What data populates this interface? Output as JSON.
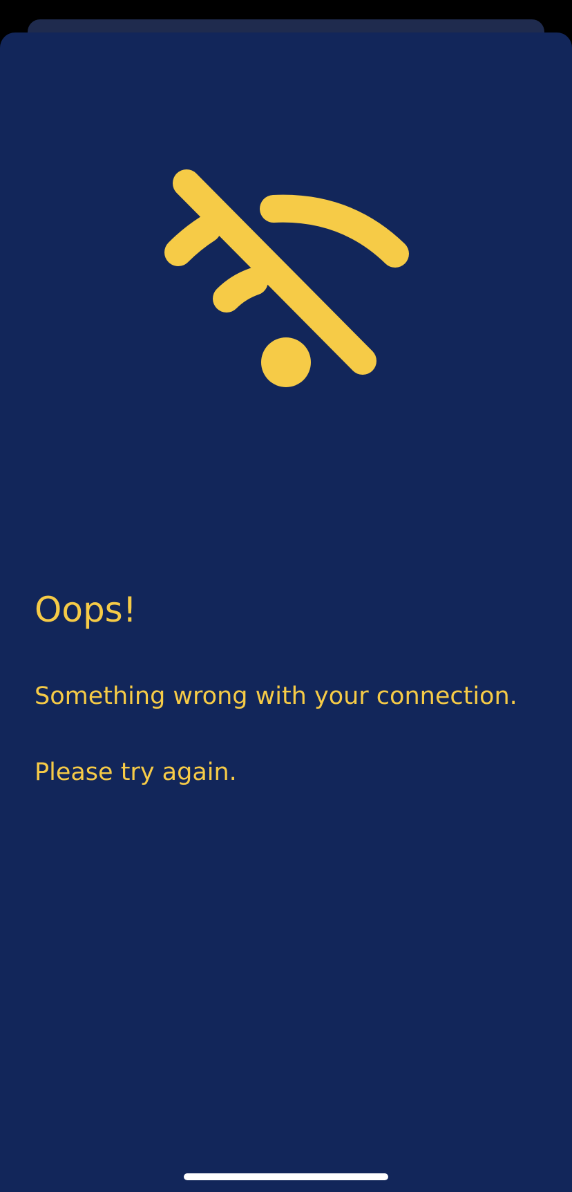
{
  "theme": {
    "background": "#12265a",
    "accent": "#f6cb47",
    "indicator": "#ffffff"
  },
  "icon": {
    "name": "wifi-off-icon"
  },
  "error": {
    "title": "Oops!",
    "message_line1": "Something wrong with your connection.",
    "message_line2": "Please try again."
  }
}
